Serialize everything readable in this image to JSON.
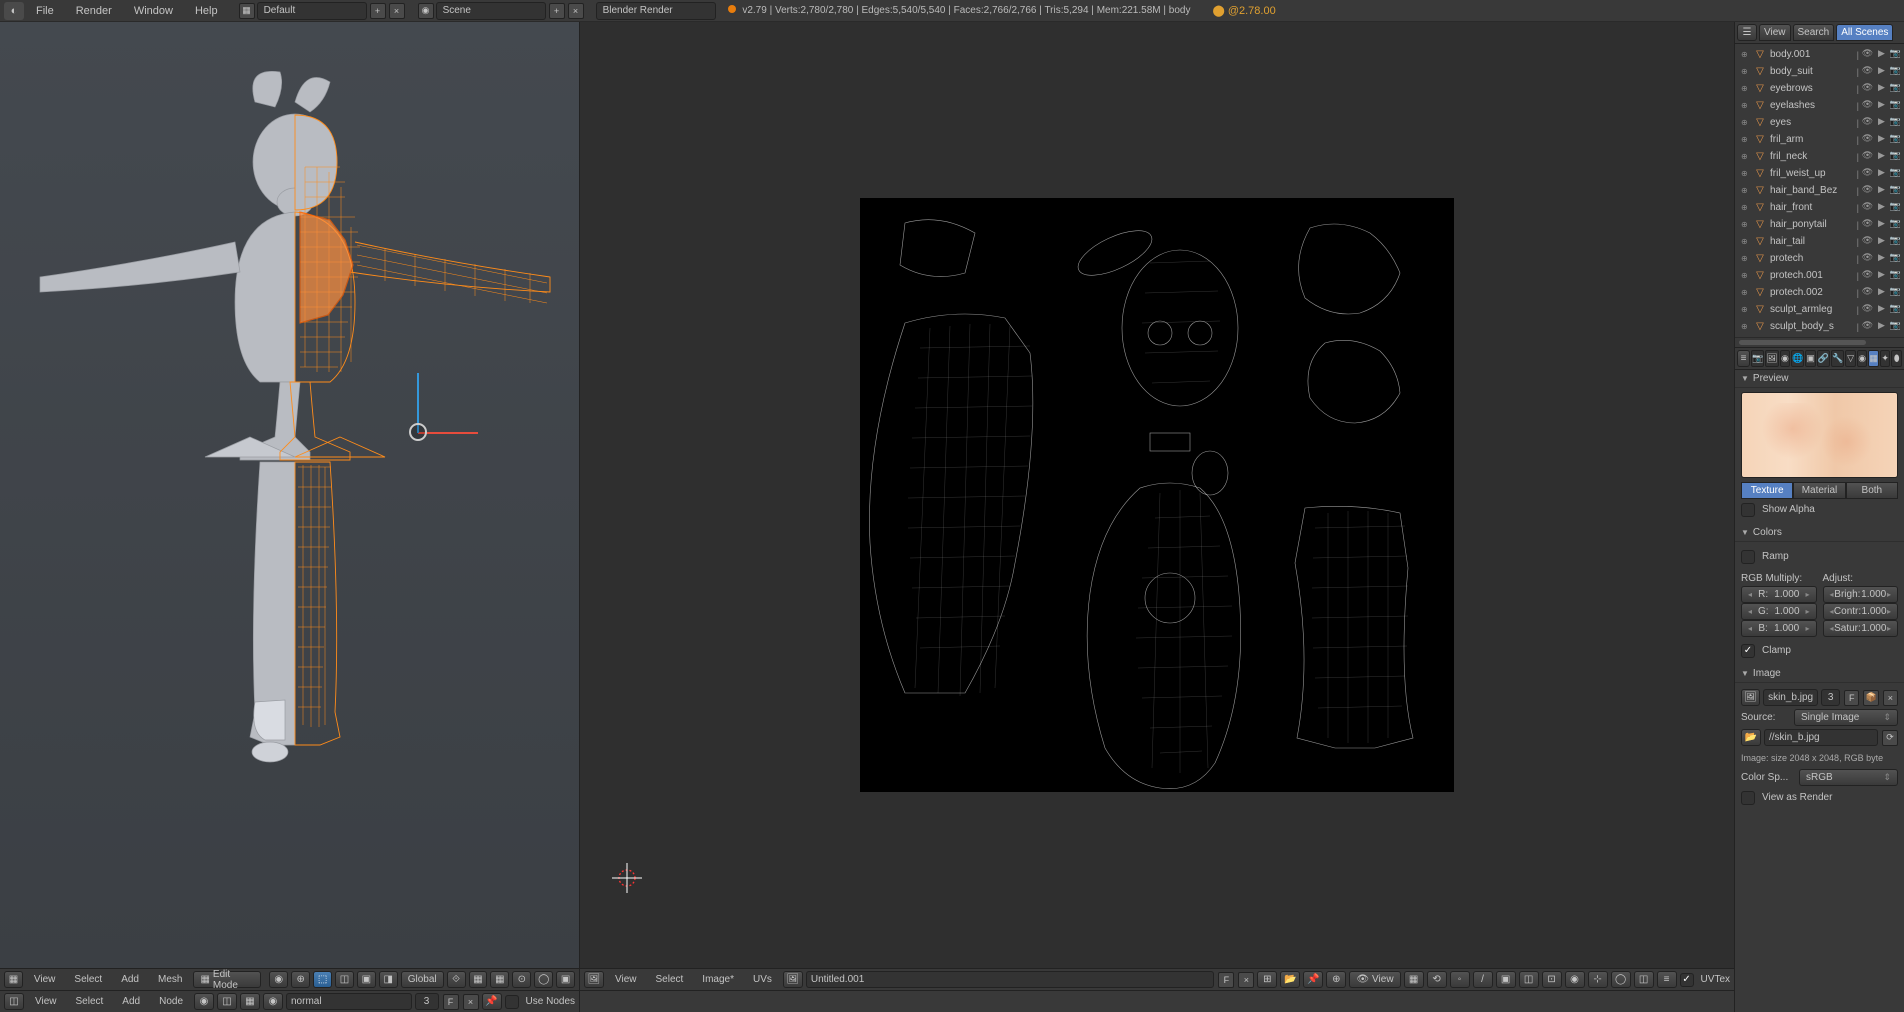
{
  "top_menu": {
    "items": [
      "File",
      "Render",
      "Window",
      "Help"
    ],
    "layout_field": "Default",
    "scene_field": "Scene",
    "engine": "Blender Render",
    "version": "v2.79",
    "stats": "Verts:2,780/2,780 | Edges:5,540/5,540 | Faces:2,766/2,766 | Tris:5,294 | Mem:221.58M | body",
    "version_tag": "@2.78.00"
  },
  "viewport3d": {
    "header": {
      "menus": [
        "View",
        "Select",
        "Add",
        "Mesh"
      ],
      "mode": "Edit Mode",
      "orientation": "Global"
    }
  },
  "uv_editor": {
    "header": {
      "menus": [
        "View",
        "Select",
        "Image*",
        "UVs"
      ],
      "image_name": "Untitled.001",
      "view_btn": "View",
      "uvtex": "UVTex"
    }
  },
  "node_editor": {
    "header": {
      "menus": [
        "View",
        "Select",
        "Add",
        "Node"
      ],
      "datablock": "normal",
      "slot": "3",
      "fake_user": "F",
      "use_nodes_label": "Use Nodes"
    }
  },
  "outliner": {
    "tabs": [
      "View",
      "Search",
      "All Scenes"
    ],
    "items": [
      {
        "name": "body.001"
      },
      {
        "name": "body_suit"
      },
      {
        "name": "eyebrows"
      },
      {
        "name": "eyelashes"
      },
      {
        "name": "eyes"
      },
      {
        "name": "fril_arm"
      },
      {
        "name": "fril_neck"
      },
      {
        "name": "fril_weist_up"
      },
      {
        "name": "hair_band_Bez"
      },
      {
        "name": "hair_front"
      },
      {
        "name": "hair_ponytail"
      },
      {
        "name": "hair_tail"
      },
      {
        "name": "protech"
      },
      {
        "name": "protech.001"
      },
      {
        "name": "protech.002"
      },
      {
        "name": "sculpt_armleg"
      },
      {
        "name": "sculpt_body_s"
      }
    ]
  },
  "properties": {
    "preview_title": "Preview",
    "preview_tabs": [
      "Texture",
      "Material",
      "Both"
    ],
    "show_alpha": "Show Alpha",
    "colors_title": "Colors",
    "ramp_label": "Ramp",
    "rgb_multiply": "RGB Multiply:",
    "adjust": "Adjust:",
    "channels": {
      "r": {
        "label": "R:",
        "value": "1.000"
      },
      "g": {
        "label": "G:",
        "value": "1.000"
      },
      "b": {
        "label": "B:",
        "value": "1.000"
      }
    },
    "adjustments": {
      "bright": {
        "label": "Brigh:",
        "value": "1.000"
      },
      "contr": {
        "label": "Contr:",
        "value": "1.000"
      },
      "satur": {
        "label": "Satur:",
        "value": "1.000"
      }
    },
    "clamp_label": "Clamp",
    "image_title": "Image",
    "image_name": "skin_b.jpg",
    "image_slot": "3",
    "fake_user": "F",
    "source_label": "Source:",
    "source_value": "Single Image",
    "filepath": "//skin_b.jpg",
    "image_info": "Image: size 2048 x 2048, RGB byte",
    "colorspace_label": "Color Sp...",
    "colorspace_value": "sRGB",
    "view_as_render": "View as Render"
  }
}
